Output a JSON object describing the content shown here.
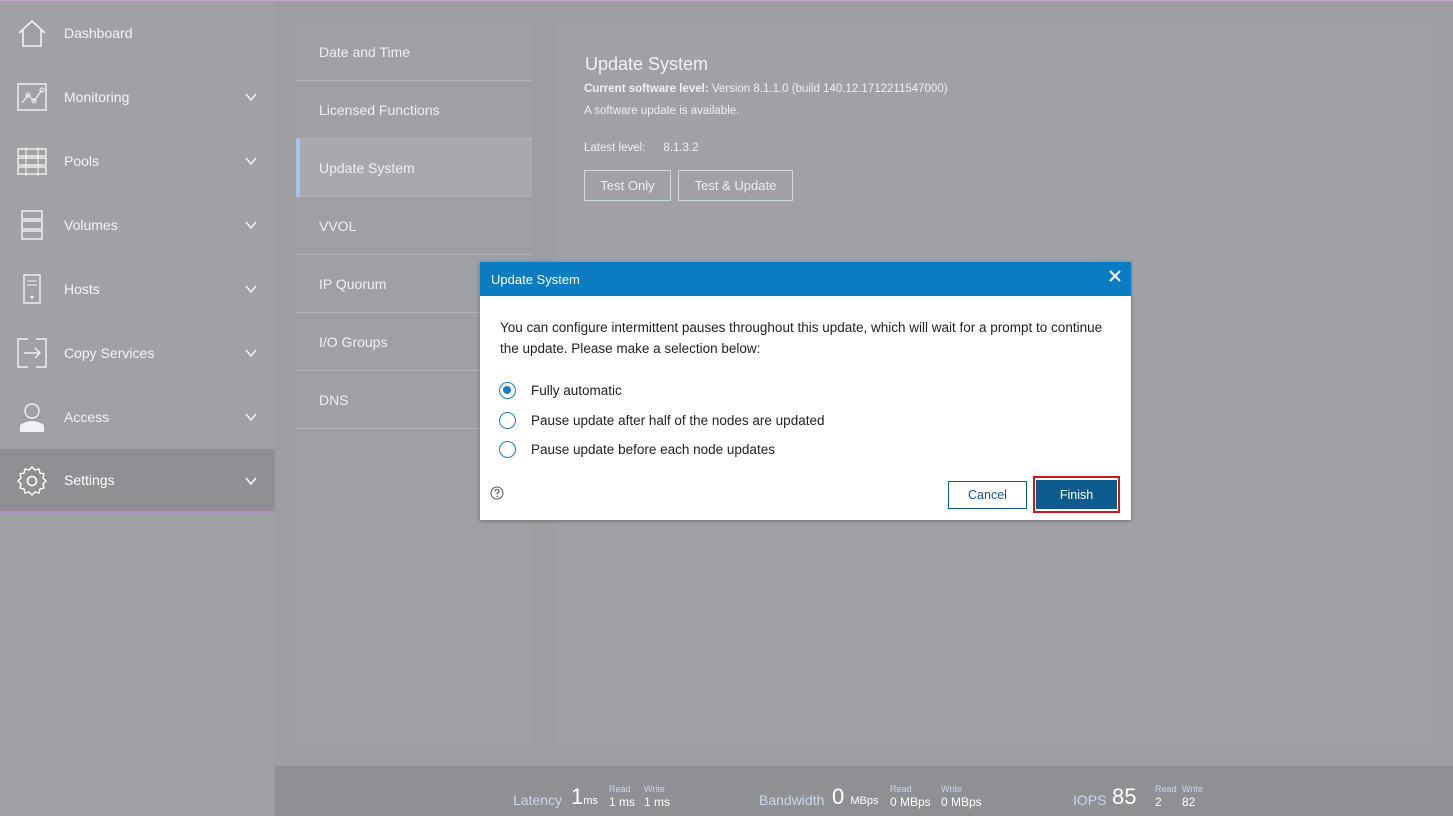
{
  "sidebar": {
    "items": [
      {
        "label": "Dashboard",
        "icon": "home-icon"
      },
      {
        "label": "Monitoring",
        "icon": "monitoring-icon"
      },
      {
        "label": "Pools",
        "icon": "pools-icon"
      },
      {
        "label": "Volumes",
        "icon": "volumes-icon"
      },
      {
        "label": "Hosts",
        "icon": "hosts-icon"
      },
      {
        "label": "Copy Services",
        "icon": "copy-services-icon"
      },
      {
        "label": "Access",
        "icon": "user-icon"
      },
      {
        "label": "Settings",
        "icon": "gear-icon"
      }
    ],
    "active": "Settings"
  },
  "subnav": {
    "items": [
      "Date and Time",
      "Licensed Functions",
      "Update System",
      "VVOL",
      "IP Quorum",
      "I/O Groups",
      "DNS"
    ],
    "active": "Update System"
  },
  "content": {
    "title": "Update System",
    "current_level_label": "Current software level:",
    "current_level_value": "Version 8.1.1.0 (build 140.12.1712211547000)",
    "available_text": "A software update is available.",
    "latest_label": "Latest level:",
    "latest_value": "8.1.3.2",
    "test_only_label": "Test Only",
    "test_update_label": "Test & Update"
  },
  "modal": {
    "title": "Update System",
    "message": "You can configure intermittent pauses throughout this update, which will wait for a prompt to continue the update. Please make a selection below:",
    "options": [
      {
        "label": "Fully automatic",
        "selected": true
      },
      {
        "label": "Pause update after half of the nodes are updated",
        "selected": false
      },
      {
        "label": "Pause update before each node updates",
        "selected": false
      }
    ],
    "cancel_label": "Cancel",
    "finish_label": "Finish"
  },
  "footer": {
    "latency": {
      "label": "Latency",
      "value": "1",
      "unit": "ms",
      "read_head": "Read",
      "read": "1 ms",
      "write_head": "Write",
      "write": "1 ms"
    },
    "bandwidth": {
      "label": "Bandwidth",
      "value": "0",
      "unit": "MBps",
      "read_head": "Read",
      "read": "0 MBps",
      "write_head": "Write",
      "write": "0 MBps"
    },
    "iops": {
      "label": "IOPS",
      "value": "85",
      "read_head": "Read",
      "read": "2",
      "write_head": "Write",
      "write": "82"
    }
  },
  "colors": {
    "modal_header": "#0a7cc1",
    "primary_button": "#0e5b8f",
    "highlight_frame": "#d0161f"
  }
}
